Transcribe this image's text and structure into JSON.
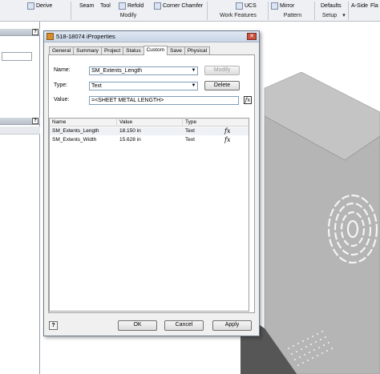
{
  "ribbon": {
    "items": [
      {
        "label": "Derive"
      },
      {
        "label": "Seam"
      },
      {
        "label": "Tool"
      },
      {
        "label": "Refold"
      },
      {
        "label": "Corner Chamfer"
      },
      {
        "label": "UCS"
      },
      {
        "label": "Mirror"
      },
      {
        "label": "Defaults"
      },
      {
        "label": "A-Side"
      },
      {
        "label": "Fla"
      }
    ],
    "groups": [
      "Modify",
      "Work Features",
      "Pattern",
      "Setup"
    ]
  },
  "dialog": {
    "title": "518-18074 iProperties",
    "close_symbol": "✕",
    "tabs": [
      "General",
      "Summary",
      "Project",
      "Status",
      "Custom",
      "Save",
      "Physical"
    ],
    "active_tab": "Custom",
    "name_label": "Name:",
    "name_value": "SM_Extents_Length",
    "type_label": "Type:",
    "type_value": "Text",
    "value_label": "Value:",
    "value_text": "=<SHEET METAL LENGTH>",
    "modify_label": "Modify",
    "delete_label": "Delete",
    "fx_symbol": "fx",
    "columns": [
      "Name",
      "Value",
      "Type"
    ],
    "rows": [
      {
        "name": "SM_Extents_Length",
        "value": "18.150 in",
        "type": "Text",
        "fx": "fx"
      },
      {
        "name": "SM_Extents_Width",
        "value": "15.628 in",
        "type": "Text",
        "fx": "fx"
      }
    ],
    "help_symbol": "?",
    "ok_label": "OK",
    "cancel_label": "Cancel",
    "apply_label": "Apply"
  },
  "panel": {
    "help_symbol": "?"
  },
  "colors": {
    "part_face": "#b8b8b8",
    "part_side": "#8a8a8a",
    "part_front": "#5e5e5e"
  }
}
